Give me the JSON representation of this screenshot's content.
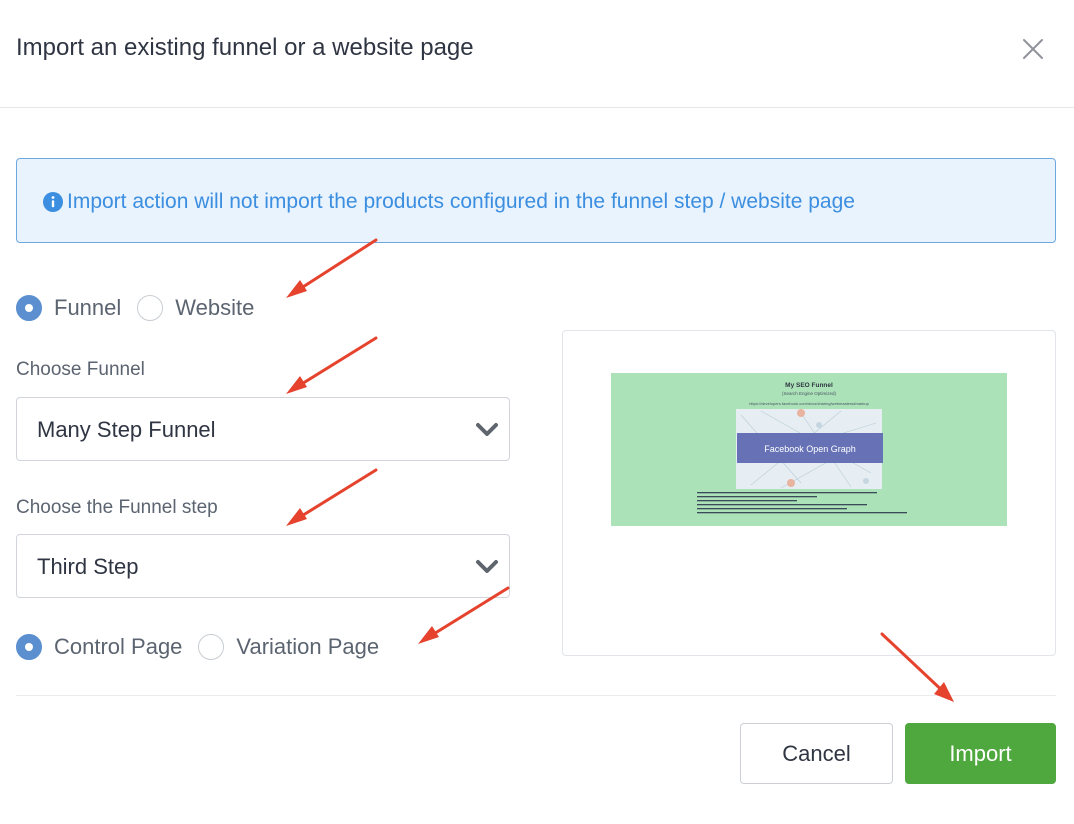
{
  "dialog": {
    "title": "Import an existing funnel or a website page",
    "close_icon": "close-icon"
  },
  "alert": {
    "icon": "info-icon",
    "text": "Import action will not import the products configured in the funnel step / website page",
    "color": "#3c8ee0"
  },
  "source_type": {
    "options": [
      {
        "label": "Funnel",
        "checked": true
      },
      {
        "label": "Website",
        "checked": false
      }
    ]
  },
  "choose_funnel": {
    "label": "Choose Funnel",
    "value": "Many Step Funnel"
  },
  "choose_step": {
    "label": "Choose the Funnel step",
    "value": "Third Step"
  },
  "page_type": {
    "options": [
      {
        "label": "Control Page",
        "checked": true
      },
      {
        "label": "Variation Page",
        "checked": false
      }
    ]
  },
  "preview": {
    "title": "My SEO Funnel",
    "subtitle": "(Search Engine Optimized)",
    "url": "https://developers.facebook.com/docs/sharing/webmasters#markup",
    "banner": "Facebook Open Graph"
  },
  "footer": {
    "cancel_label": "Cancel",
    "import_label": "Import",
    "import_color": "#4fa83d"
  },
  "colors": {
    "radio_checked": "#5b8fcf",
    "annotation_arrow": "#e5432d",
    "preview_background": "#abe2b8"
  }
}
